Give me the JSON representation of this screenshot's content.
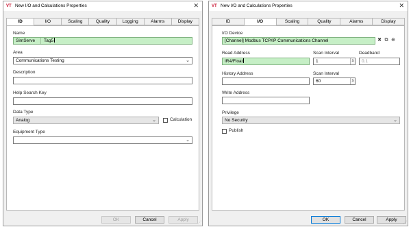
{
  "left": {
    "title": "New I/O and Calculations Properties",
    "app_icon": "VT",
    "close": "✕",
    "tabs": [
      {
        "label": "ID",
        "active": true
      },
      {
        "label": "I/O"
      },
      {
        "label": "Scaling"
      },
      {
        "label": "Quality"
      },
      {
        "label": "Logging"
      },
      {
        "label": "Alarms"
      },
      {
        "label": "Display"
      }
    ],
    "name_label": "Name",
    "name_prefix": "SimServe",
    "name_value": "Tag5",
    "area_label": "Area",
    "area_value": "Communications Testing",
    "description_label": "Description",
    "description_value": "",
    "help_label": "Help Search Key",
    "help_value": "",
    "datatype_label": "Data Type",
    "datatype_value": "Analog",
    "calculation_label": "Calculation",
    "equipment_label": "Equipment Type",
    "equipment_value": "",
    "buttons": {
      "ok": "OK",
      "cancel": "Cancel",
      "apply": "Apply"
    }
  },
  "right": {
    "title": "New I/O and Calculations Properties",
    "app_icon": "VT",
    "close": "✕",
    "tabs": [
      {
        "label": "ID"
      },
      {
        "label": "I/O",
        "active": true
      },
      {
        "label": "Scaling"
      },
      {
        "label": "Quality"
      },
      {
        "label": "Alarms"
      },
      {
        "label": "Display"
      }
    ],
    "io_device_label": "I/O Device",
    "io_device_value": "[Channel]   Modbus TCP/IP Communications Channel",
    "read_address_label": "Read Address",
    "read_address_value": "IR4/Float",
    "scan_interval_label": "Scan Interval",
    "scan_interval_value": "1",
    "scan_interval_unit": "s",
    "deadband_label": "Deadband",
    "deadband_value": "0.1",
    "history_address_label": "History Address",
    "history_address_value": "",
    "history_scan_label": "Scan Interval",
    "history_scan_value": "60",
    "history_scan_unit": "s",
    "write_address_label": "Write Address",
    "write_address_value": "",
    "privilege_label": "Privilege",
    "privilege_value": "No Security",
    "publish_label": "Publish",
    "buttons": {
      "ok": "OK",
      "cancel": "Cancel",
      "apply": "Apply"
    }
  },
  "colors": {
    "accent": "#0078d7",
    "field_highlight": "#c6efc6",
    "app_icon_red": "#c8102e"
  }
}
